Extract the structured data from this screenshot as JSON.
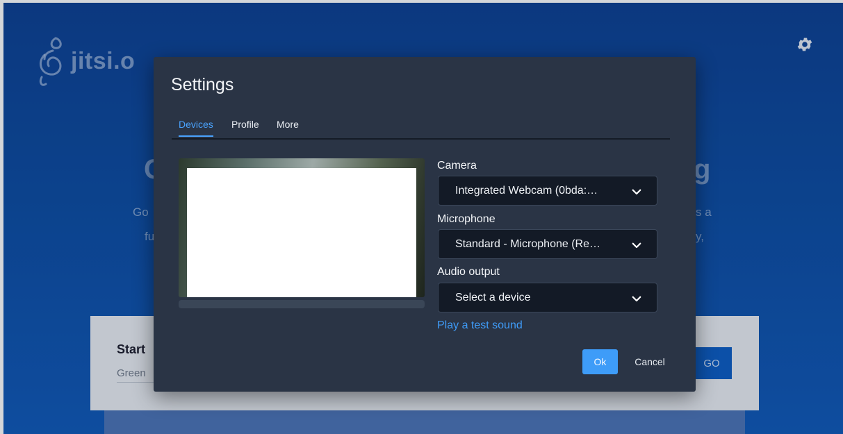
{
  "background": {
    "logo_text": "jitsi.o",
    "title_left": "G",
    "title_right": "g",
    "desc_line1_left": "Go",
    "desc_line1_right": "s a",
    "desc_line2_left": "fu",
    "desc_line2_right": "y,",
    "start_title": "Start",
    "room_input_value": "Green",
    "go_label": "GO",
    "settings_icon": "gear-icon"
  },
  "dialog": {
    "title": "Settings",
    "tabs": [
      {
        "label": "Devices",
        "active": true
      },
      {
        "label": "Profile",
        "active": false
      },
      {
        "label": "More",
        "active": false
      }
    ],
    "camera_label": "Camera",
    "camera_value": "Integrated Webcam (0bda:…",
    "microphone_label": "Microphone",
    "microphone_value": "Standard - Microphone (Re…",
    "audio_output_label": "Audio output",
    "audio_output_value": "Select a device",
    "test_sound_link": "Play a test sound",
    "ok_label": "Ok",
    "cancel_label": "Cancel",
    "dropdown_icon": "chevron-down-icon"
  },
  "colors": {
    "accent": "#3e9cf8",
    "dialog_bg": "#2a3445",
    "background_blue": "#0c4aa0"
  }
}
